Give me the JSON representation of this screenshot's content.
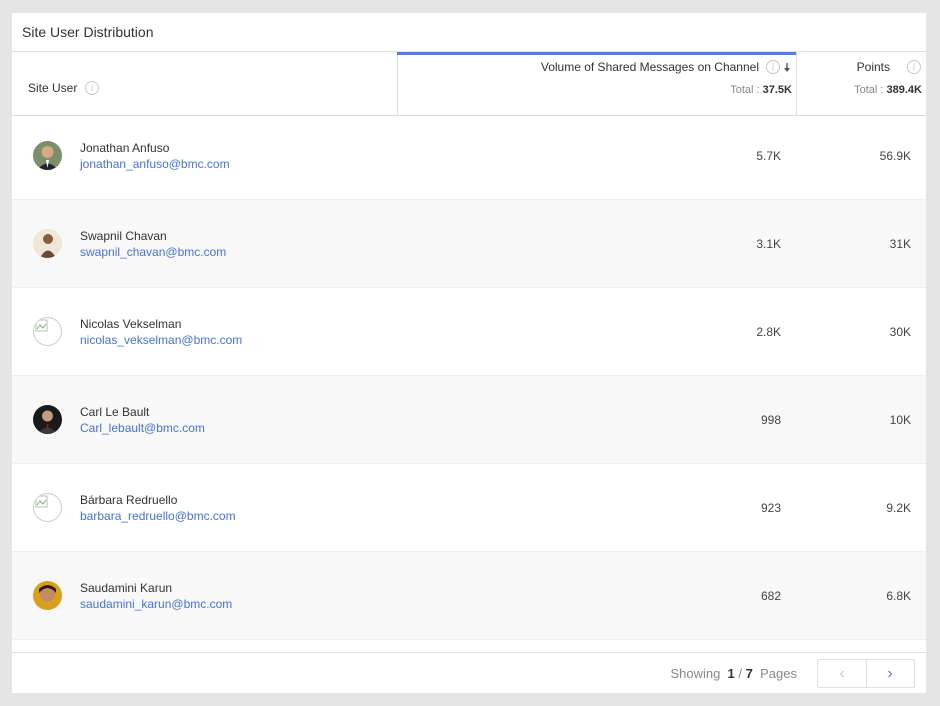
{
  "title": "Site User Distribution",
  "columns": {
    "user": "Site User",
    "volume": "Volume of Shared Messages on Channel",
    "points": "Points"
  },
  "totals": {
    "label": "Total :",
    "volume": "37.5K",
    "points": "389.4K"
  },
  "rows": [
    {
      "name": "Jonathan Anfuso",
      "email": "jonathan_anfuso@bmc.com",
      "volume": "5.7K",
      "points": "56.9K"
    },
    {
      "name": "Swapnil Chavan",
      "email": "swapnil_chavan@bmc.com",
      "volume": "3.1K",
      "points": "31K"
    },
    {
      "name": "Nicolas Vekselman",
      "email": "nicolas_vekselman@bmc.com",
      "volume": "2.8K",
      "points": "30K"
    },
    {
      "name": "Carl Le Bault",
      "email": "Carl_lebault@bmc.com",
      "volume": "998",
      "points": "10K"
    },
    {
      "name": "Bárbara Redruello",
      "email": "barbara_redruello@bmc.com",
      "volume": "923",
      "points": "9.2K"
    },
    {
      "name": "Saudamini Karun",
      "email": "saudamini_karun@bmc.com",
      "volume": "682",
      "points": "6.8K"
    }
  ],
  "pagination": {
    "showing": "Showing",
    "current": "1",
    "sep": "/",
    "total": "7",
    "pages": "Pages",
    "prev": "‹",
    "next": "›"
  },
  "colors": {
    "accent": "#5b7bd8",
    "link": "#4a72d4"
  },
  "icons": {
    "info": "info-icon",
    "sort": "sort-descending-icon"
  }
}
